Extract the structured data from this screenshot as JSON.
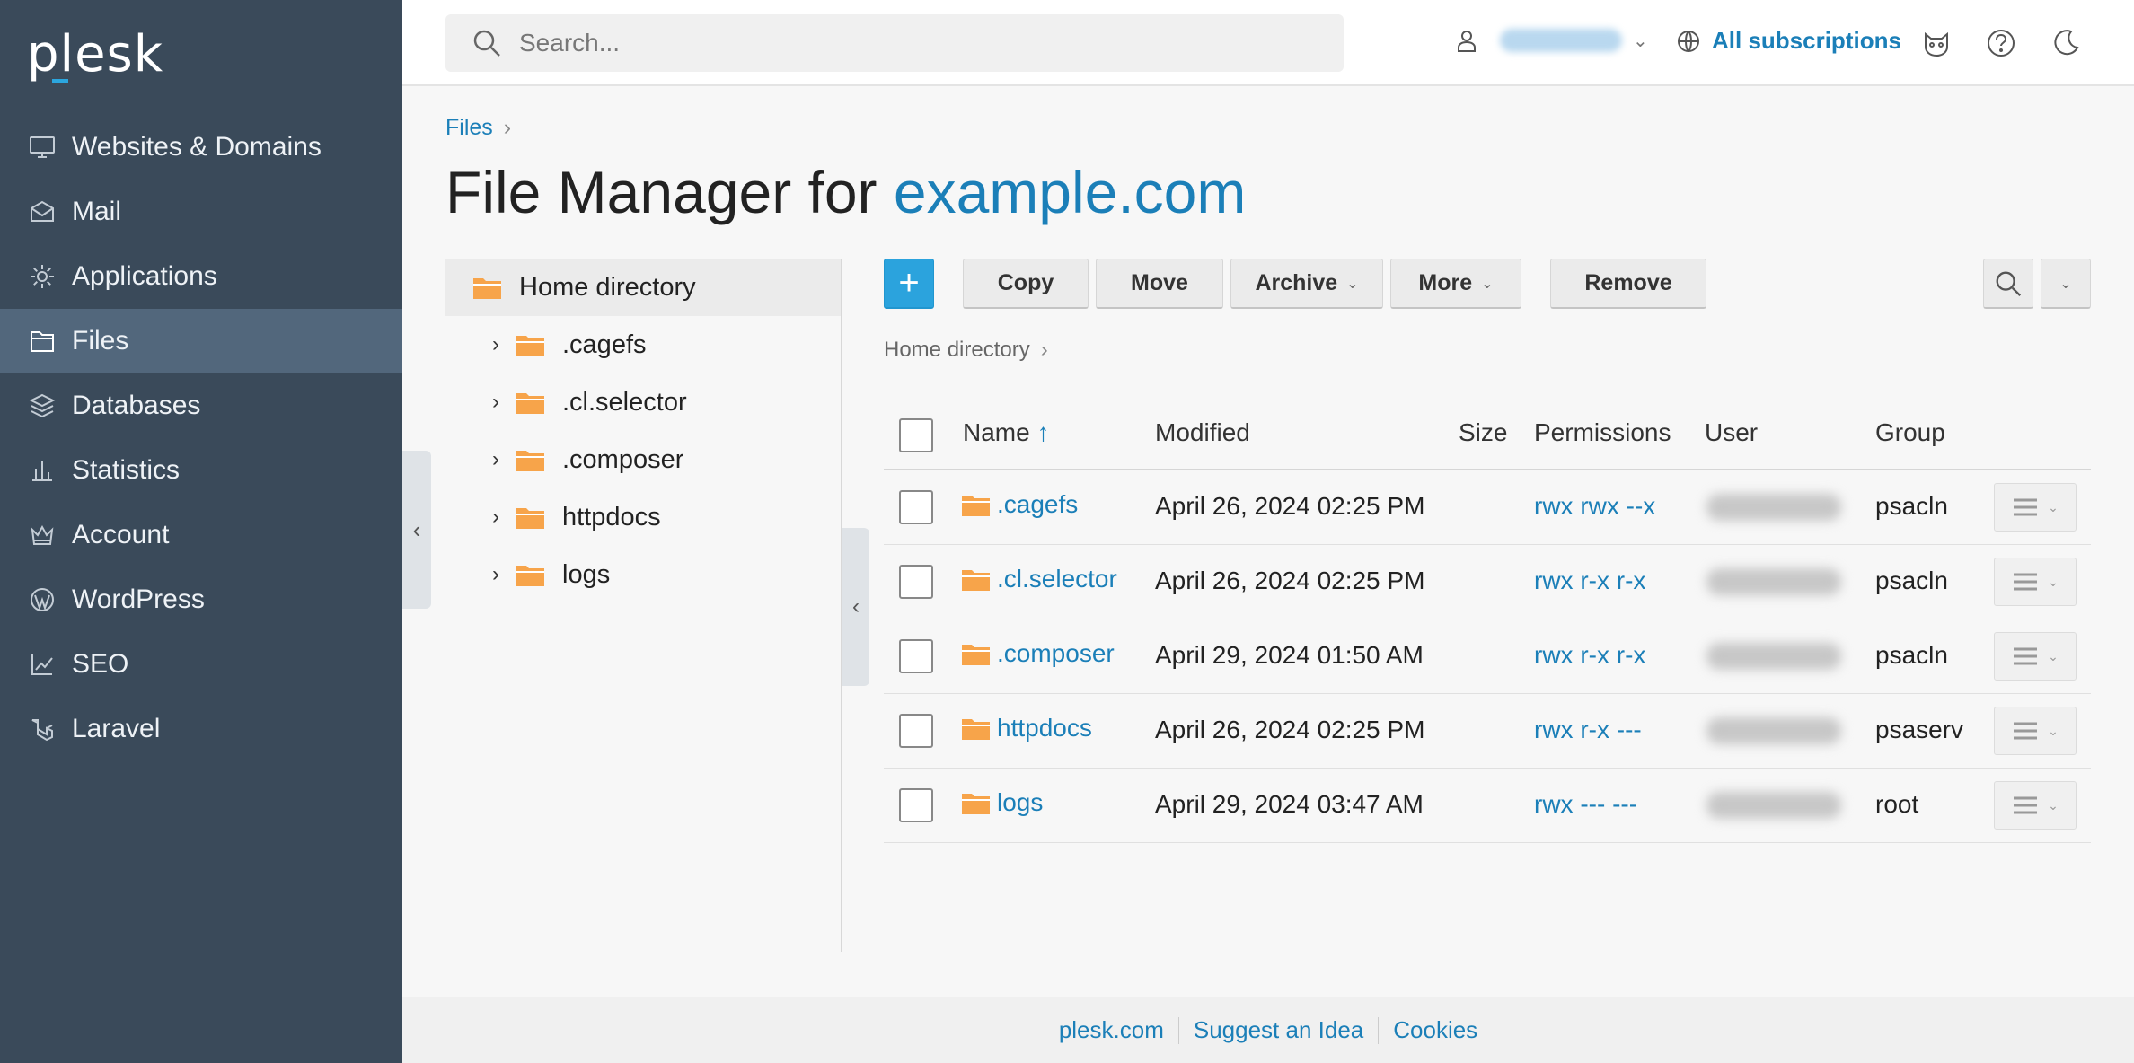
{
  "app": {
    "logo": "plesk"
  },
  "sidebar": {
    "items": [
      {
        "label": "Websites & Domains",
        "icon": "monitor-icon"
      },
      {
        "label": "Mail",
        "icon": "mail-icon"
      },
      {
        "label": "Applications",
        "icon": "gear-icon"
      },
      {
        "label": "Files",
        "icon": "folder-icon",
        "active": true
      },
      {
        "label": "Databases",
        "icon": "layers-icon"
      },
      {
        "label": "Statistics",
        "icon": "bar-chart-icon"
      },
      {
        "label": "Account",
        "icon": "crown-icon"
      },
      {
        "label": "WordPress",
        "icon": "wordpress-icon"
      },
      {
        "label": "SEO",
        "icon": "trend-icon"
      },
      {
        "label": "Laravel",
        "icon": "laravel-icon"
      }
    ]
  },
  "topbar": {
    "search_placeholder": "Search...",
    "subscriptions_label": "All subscriptions"
  },
  "breadcrumb": {
    "files": "Files"
  },
  "title": {
    "prefix": "File Manager for ",
    "domain": "example.com"
  },
  "tree": {
    "root": "Home directory",
    "items": [
      ".cagefs",
      ".cl.selector",
      ".composer",
      "httpdocs",
      "logs"
    ]
  },
  "toolbar": {
    "add": "+",
    "copy": "Copy",
    "move": "Move",
    "archive": "Archive",
    "more": "More",
    "remove": "Remove"
  },
  "path": "Home directory",
  "table": {
    "headers": {
      "name": "Name",
      "sort_arrow": "↑",
      "modified": "Modified",
      "size": "Size",
      "permissions": "Permissions",
      "user": "User",
      "group": "Group"
    },
    "rows": [
      {
        "name": ".cagefs",
        "modified": "April 26, 2024 02:25 PM",
        "size": "",
        "permissions": "rwx rwx --x",
        "group": "psacln"
      },
      {
        "name": ".cl.selector",
        "modified": "April 26, 2024 02:25 PM",
        "size": "",
        "permissions": "rwx r-x r-x",
        "group": "psacln"
      },
      {
        "name": ".composer",
        "modified": "April 29, 2024 01:50 AM",
        "size": "",
        "permissions": "rwx r-x r-x",
        "group": "psacln"
      },
      {
        "name": "httpdocs",
        "modified": "April 26, 2024 02:25 PM",
        "size": "",
        "permissions": "rwx r-x ---",
        "group": "psaserv"
      },
      {
        "name": "logs",
        "modified": "April 29, 2024 03:47 AM",
        "size": "",
        "permissions": "rwx --- ---",
        "group": "root"
      }
    ]
  },
  "footer": {
    "links": [
      "plesk.com",
      "Suggest an Idea",
      "Cookies"
    ]
  },
  "colors": {
    "sidebar": "#3a4a5a",
    "accent": "#1b7fb8",
    "add_button": "#2ba3dd",
    "folder": "#f7a44a"
  }
}
